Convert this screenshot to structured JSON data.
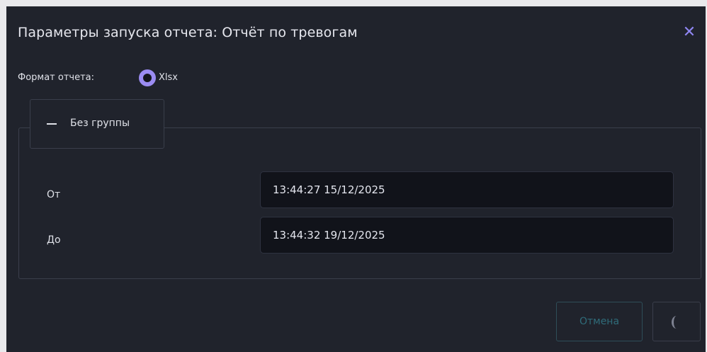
{
  "dialog": {
    "title": "Параметры запуска отчета: Отчёт по тревогам",
    "close_icon": "close-icon"
  },
  "format": {
    "label": "Формат отчета:",
    "option": "Xlsx",
    "selected": true
  },
  "group": {
    "label": "Без группы",
    "icon": "collapse-minus-icon"
  },
  "fields": {
    "from_label": "От",
    "from_value": "13:44:27 15/12/2025",
    "to_label": "До",
    "to_value": "13:44:32 19/12/2025"
  },
  "buttons": {
    "cancel_label": "Отмена",
    "ok_icon": "loading-spinner-icon"
  },
  "colors": {
    "background": "#20232c",
    "accent": "#9b8cf2",
    "input_bg": "#11131a"
  }
}
